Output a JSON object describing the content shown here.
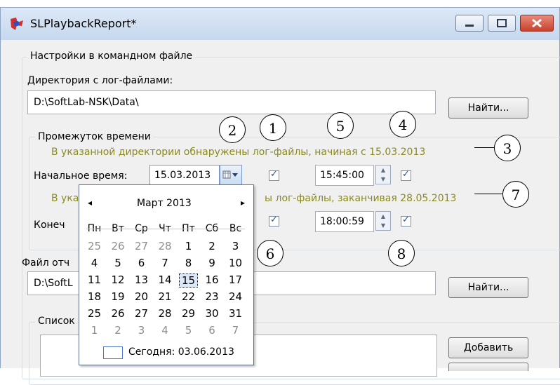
{
  "window": {
    "title": "SLPlaybackReport*"
  },
  "settings_group": {
    "caption": "Настройки в командном файле"
  },
  "log_dir": {
    "label": "Директория с лог-файлами:",
    "value": "D:\\SoftLab-NSK\\Data\\",
    "find_label": "Найти..."
  },
  "time_group": {
    "caption": "Промежуток времени",
    "info_start": "В указанной директории обнаружены лог-файлы, начиная с 15.03.2013",
    "info_end": "ы лог-файлы, заканчивая 28.05.2013",
    "info_end_prefix": "В ука",
    "start_label": "Начальное время:",
    "start_date": "15.03.2013",
    "start_time": "15:45:00",
    "end_label_partial": "Конеч",
    "end_time": "18:00:59"
  },
  "report_file": {
    "label_partial": "Файл отч",
    "value_partial": "D:\\SoftL",
    "find_label": "Найти..."
  },
  "list_group": {
    "caption_partial": "Список"
  },
  "add_button": "Добавить",
  "calendar": {
    "month_title": "Март 2013",
    "prev_arrow": "◂",
    "next_arrow": "▸",
    "weekdays": [
      "Пн",
      "Вт",
      "Ср",
      "Чт",
      "Пт",
      "Сб",
      "Вс"
    ],
    "weeks": [
      [
        {
          "d": "25",
          "dim": true
        },
        {
          "d": "26",
          "dim": true
        },
        {
          "d": "27",
          "dim": true
        },
        {
          "d": "28",
          "dim": true
        },
        {
          "d": "1"
        },
        {
          "d": "2"
        },
        {
          "d": "3"
        }
      ],
      [
        {
          "d": "4"
        },
        {
          "d": "5"
        },
        {
          "d": "6"
        },
        {
          "d": "7"
        },
        {
          "d": "8"
        },
        {
          "d": "9"
        },
        {
          "d": "10"
        }
      ],
      [
        {
          "d": "11"
        },
        {
          "d": "12"
        },
        {
          "d": "13"
        },
        {
          "d": "14"
        },
        {
          "d": "15",
          "selected": true
        },
        {
          "d": "16"
        },
        {
          "d": "17"
        }
      ],
      [
        {
          "d": "18"
        },
        {
          "d": "19"
        },
        {
          "d": "20"
        },
        {
          "d": "21"
        },
        {
          "d": "22"
        },
        {
          "d": "23"
        },
        {
          "d": "24"
        }
      ],
      [
        {
          "d": "25"
        },
        {
          "d": "26"
        },
        {
          "d": "27"
        },
        {
          "d": "28"
        },
        {
          "d": "29"
        },
        {
          "d": "30"
        },
        {
          "d": "31"
        }
      ],
      [
        {
          "d": "1",
          "dim": true
        },
        {
          "d": "2",
          "dim": true
        },
        {
          "d": "3",
          "dim": true
        },
        {
          "d": "4",
          "dim": true
        },
        {
          "d": "5",
          "dim": true
        },
        {
          "d": "6",
          "dim": true
        },
        {
          "d": "7",
          "dim": true
        }
      ]
    ],
    "today_label": "Сегодня: 03.06.2013"
  },
  "callouts": [
    "1",
    "2",
    "3",
    "4",
    "5",
    "6",
    "7",
    "8"
  ],
  "colors": {
    "info_text": "#8a8a1e",
    "title_gradient_top": "#dce8f6",
    "close_button": "#c8412b"
  }
}
